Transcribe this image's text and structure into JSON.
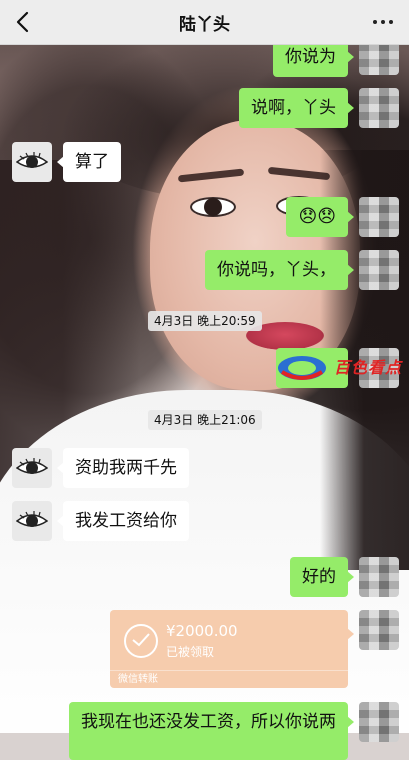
{
  "header": {
    "title": "陆丫头",
    "back_icon": "chevron-left-icon",
    "more_icon": "more-dots-icon"
  },
  "messages": [
    {
      "side": "me",
      "text": "你说为"
    },
    {
      "side": "me",
      "text": "说啊，丫头"
    },
    {
      "side": "other",
      "text": "算了"
    },
    {
      "side": "me",
      "text": "😞😞"
    },
    {
      "side": "me",
      "text": "你说吗，丫头，"
    },
    {
      "side": "me",
      "text": "百色看点"
    },
    {
      "side": "other",
      "text": "资助我两千先"
    },
    {
      "side": "other",
      "text": "我发工资给你"
    },
    {
      "side": "me",
      "text": "好的"
    },
    {
      "side": "me",
      "text": "我现在也还没发工资，所以你说两"
    }
  ],
  "timestamps": [
    "4月3日 晚上20:59",
    "4月3日 晚上21:06"
  ],
  "transfer": {
    "amount": "¥2000.00",
    "status": "已被领取",
    "footer": "微信转账"
  },
  "colors": {
    "my_bubble": "#95ec69",
    "other_bubble": "#ffffff",
    "transfer_card": "#f6ccad",
    "header_bg": "#ededed"
  }
}
